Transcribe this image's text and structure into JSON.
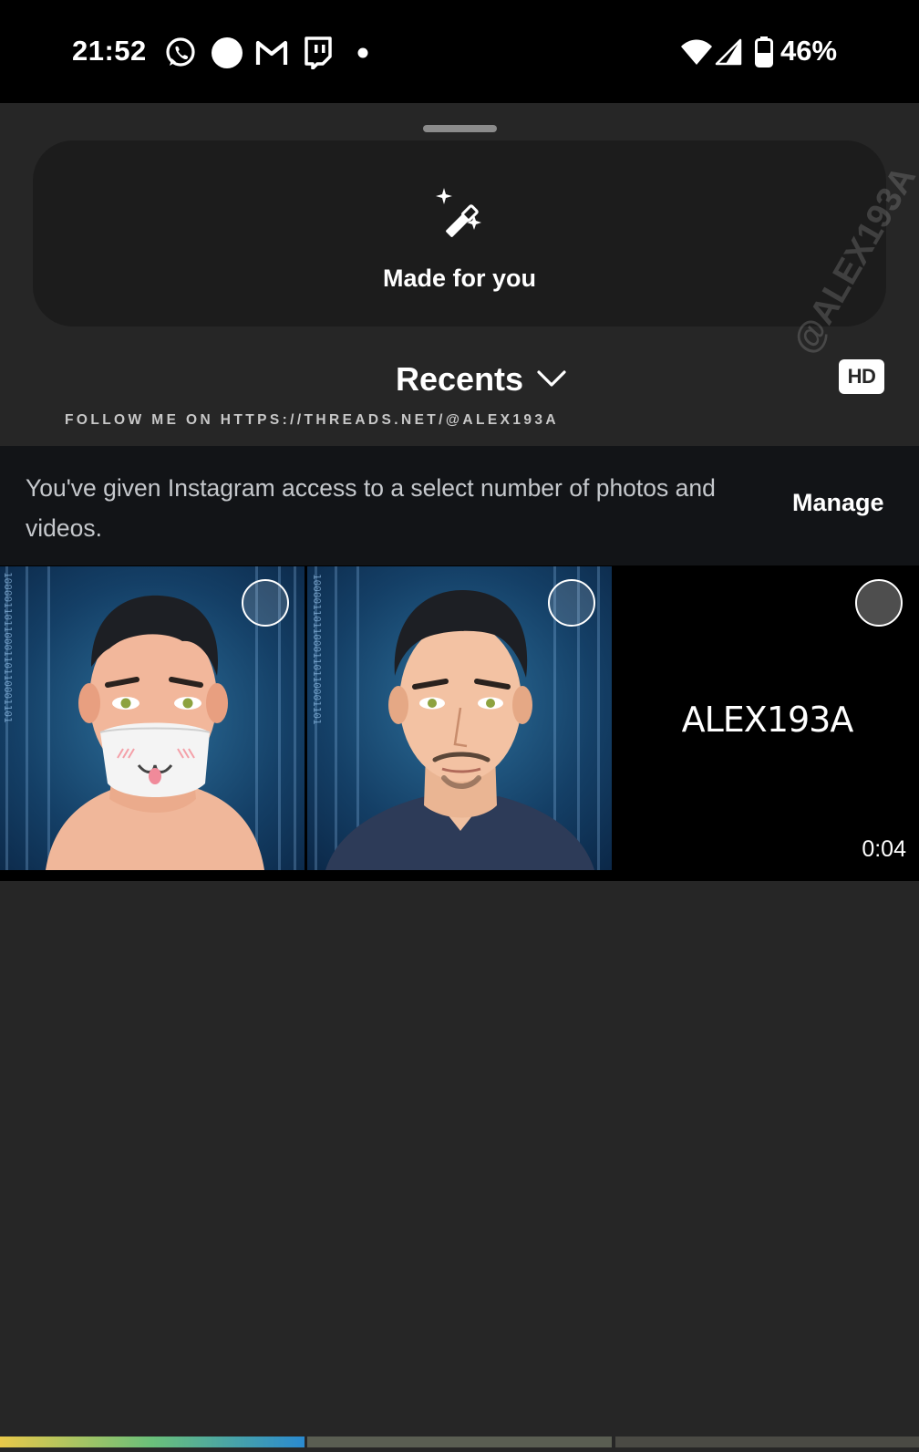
{
  "status_bar": {
    "time": "21:52",
    "notification_icons": [
      "whatsapp-icon",
      "dot-circle-icon",
      "gmail-icon",
      "twitch-icon",
      "more-dot-icon"
    ],
    "battery_percent": "46%"
  },
  "sheet": {
    "made_for_you": {
      "label": "Made for you",
      "icon": "magic-wand-icon"
    },
    "recents": {
      "label": "Recents",
      "icon": "chevron-down-icon"
    },
    "hd_badge": "HD",
    "overlay_caption": "FOLLOW ME ON HTTPS://THREADS.NET/@ALEX193A",
    "watermark": "@ALEX193A"
  },
  "access_banner": {
    "message": "You've given Instagram access to a select number of photos and videos.",
    "action": "Manage"
  },
  "media_grid": [
    {
      "type": "photo",
      "description": "cartoon portrait with mask"
    },
    {
      "type": "photo",
      "description": "cartoon portrait"
    },
    {
      "type": "video",
      "overlay_text": "ALEX193A",
      "duration": "0:04"
    }
  ],
  "colors": {
    "status_bar_bg": "#000000",
    "sheet_bg": "#262626",
    "card_bg": "#1c1c1c",
    "banner_bg": "#121417"
  }
}
